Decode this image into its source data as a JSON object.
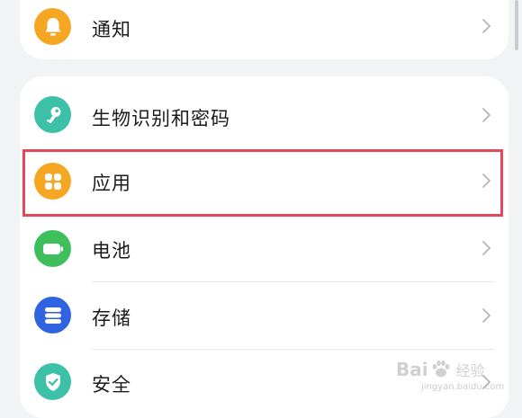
{
  "settings": {
    "notification": {
      "label": "通知",
      "icon": "bell-icon",
      "color": "#f5a623"
    },
    "items": [
      {
        "label": "生物识别和密码",
        "icon": "key-icon",
        "color": "#3cc0a8"
      },
      {
        "label": "应用",
        "icon": "apps-grid-icon",
        "color": "#f5a623"
      },
      {
        "label": "电池",
        "icon": "battery-icon",
        "color": "#3fbf5b"
      },
      {
        "label": "存储",
        "icon": "storage-icon",
        "color": "#2f63e0"
      },
      {
        "label": "安全",
        "icon": "shield-check-icon",
        "color": "#3cc0a8"
      }
    ]
  },
  "highlight": {
    "target": "应用",
    "color": "#e8465a"
  },
  "watermark": {
    "text": "Bai",
    "text_end": "经验",
    "url": "jingyan.baidu.com"
  }
}
